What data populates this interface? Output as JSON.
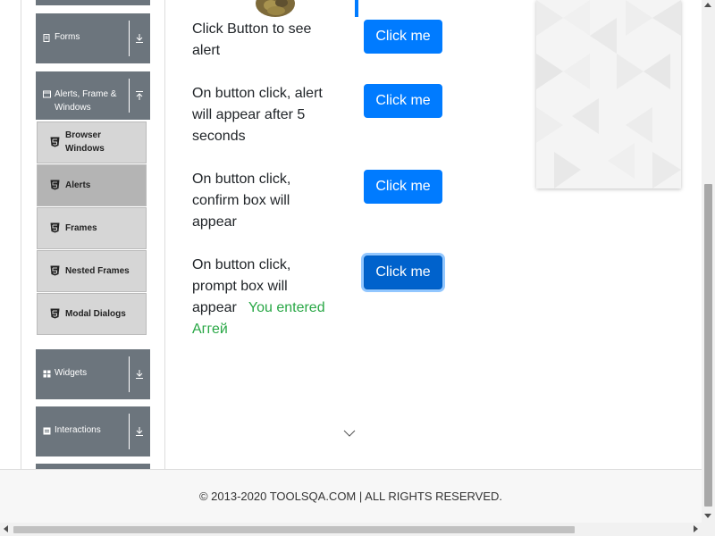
{
  "sidebar": {
    "groups": {
      "forms": {
        "label": "Forms",
        "icon": "form-icon"
      },
      "alerts": {
        "label": "Alerts, Frame & Windows",
        "icon": "window-icon"
      },
      "widgets": {
        "label": "Widgets",
        "icon": "widgets-icon"
      },
      "interactions": {
        "label": "Interactions",
        "icon": "interactions-icon"
      }
    },
    "sub_items": [
      {
        "label": "Browser Windows",
        "icon": "html5-icon"
      },
      {
        "label": "Alerts",
        "icon": "html5-icon",
        "active": true
      },
      {
        "label": "Frames",
        "icon": "html5-icon"
      },
      {
        "label": "Nested Frames",
        "icon": "html5-icon"
      },
      {
        "label": "Modal Dialogs",
        "icon": "html5-icon"
      }
    ]
  },
  "main": {
    "rows": [
      {
        "text": "Click Button to see alert",
        "button": "Click me"
      },
      {
        "text": "On button click, alert will appear after 5 seconds",
        "button": "Click me"
      },
      {
        "text": "On button click, confirm box will appear",
        "button": "Click me"
      },
      {
        "text": "On button click, prompt box will appear",
        "button": "Click me",
        "result": "You entered Аггей"
      }
    ]
  },
  "footer": {
    "text": "© 2013-2020 TOOLSQA.COM | ALL RIGHTS RESERVED."
  },
  "colors": {
    "primary": "#007bff",
    "sidebar_group": "#6c757d",
    "sidebar_sub": "#d6d6d6",
    "sidebar_active": "#b4b4b4",
    "success": "#28a745"
  }
}
